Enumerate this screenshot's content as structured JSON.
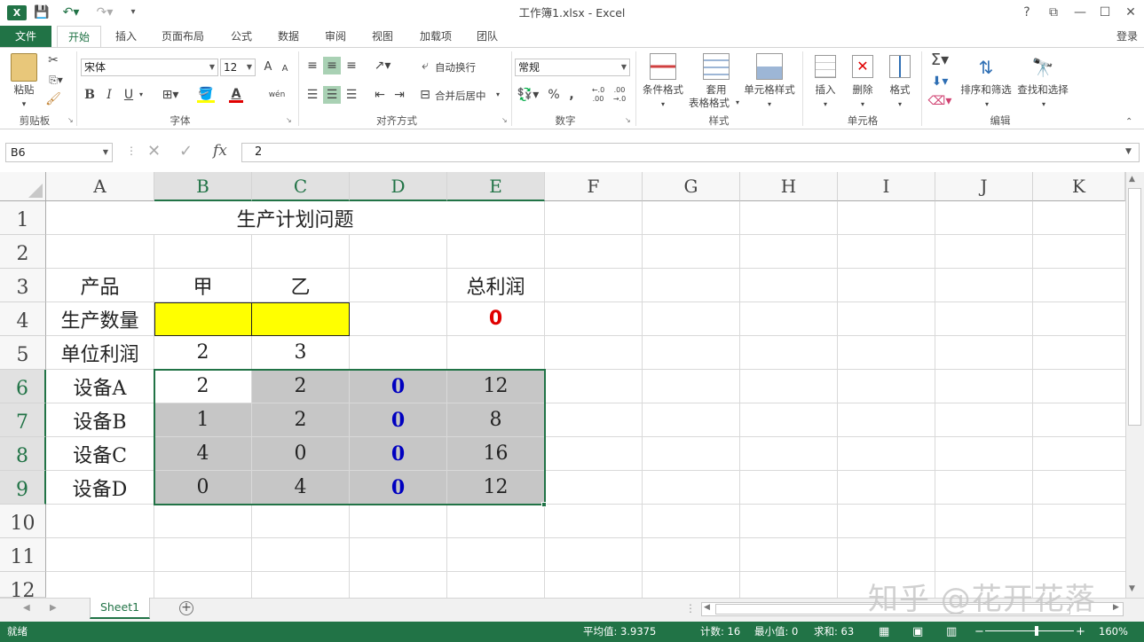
{
  "app": {
    "title": "工作簿1.xlsx - Excel",
    "login": "登录",
    "help": "?",
    "restore": "⧉",
    "minimize": "—",
    "maximize": "☐",
    "close": "✕"
  },
  "ribbon_tabs": [
    "文件",
    "开始",
    "插入",
    "页面布局",
    "公式",
    "数据",
    "审阅",
    "视图",
    "加载项",
    "团队"
  ],
  "ribbon": {
    "clipboard": {
      "paste": "粘贴",
      "label": "剪贴板"
    },
    "font": {
      "name": "宋体",
      "size": "12",
      "label": "字体",
      "bold": "B",
      "italic": "I",
      "underline": "U",
      "grow": "A",
      "shrink": "A",
      "fontcolor": "A",
      "phonetic": "wén"
    },
    "alignment": {
      "wrap": "自动换行",
      "merge": "合并后居中",
      "label": "对齐方式"
    },
    "number": {
      "format": "常规",
      "percent": "%",
      "comma": ",",
      "inc": "←.0 .00",
      "dec": ".00 →.0",
      "label": "数字"
    },
    "styles": {
      "conditional": "条件格式",
      "table1": "套用",
      "table2": "表格格式",
      "cell": "单元格样式",
      "label": "样式"
    },
    "cells": {
      "insert": "插入",
      "delete": "删除",
      "format": "格式",
      "label": "单元格"
    },
    "editing": {
      "sort": "排序和筛选",
      "find": "查找和选择",
      "label": "编辑"
    }
  },
  "formula_bar": {
    "name_box": "B6",
    "value": "2",
    "fx": "fx"
  },
  "columns": [
    "A",
    "B",
    "C",
    "D",
    "E",
    "F",
    "G",
    "H",
    "I",
    "J",
    "K"
  ],
  "rows": [
    "1",
    "2",
    "3",
    "4",
    "5",
    "6",
    "7",
    "8",
    "9",
    "10",
    "11",
    "12"
  ],
  "sheet": {
    "title": "生产计划问题",
    "r3": {
      "a": "产品",
      "b": "甲",
      "c": "乙",
      "e": "总利润"
    },
    "r4": {
      "a": "生产数量",
      "e": "0"
    },
    "r5": {
      "a": "单位利润",
      "b": "2",
      "c": "3"
    },
    "r6": {
      "a": "设备A",
      "b": "2",
      "c": "2",
      "d": "0",
      "e": "12"
    },
    "r7": {
      "a": "设备B",
      "b": "1",
      "c": "2",
      "d": "0",
      "e": "8"
    },
    "r8": {
      "a": "设备C",
      "b": "4",
      "c": "0",
      "d": "0",
      "e": "16"
    },
    "r9": {
      "a": "设备D",
      "b": "0",
      "c": "4",
      "d": "0",
      "e": "12"
    }
  },
  "sheet_tabs": {
    "active": "Sheet1",
    "add": "+"
  },
  "status": {
    "ready": "就绪",
    "average": "平均值: 3.9375",
    "count": "计数: 16",
    "min": "最小值: 0",
    "sum": "求和: 63",
    "zoom": "160%"
  },
  "watermark": "知乎 @花开花落",
  "colors": {
    "excel_green": "#217346",
    "input_yellow": "#ffff00",
    "range_grey": "#c6c6c6",
    "formula_blue": "#0000c0",
    "total_red": "#e00000"
  }
}
